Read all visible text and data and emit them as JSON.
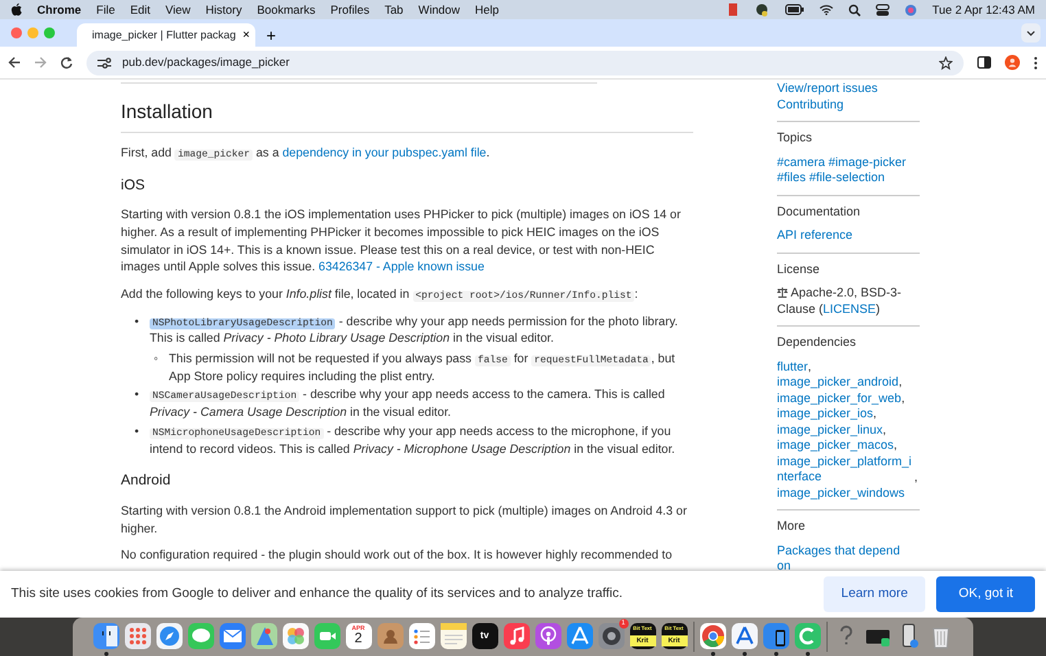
{
  "menu_bar": {
    "items": [
      {
        "label": "Chrome",
        "kind": "app"
      },
      {
        "label": "File",
        "kind": "menu"
      },
      {
        "label": "Edit",
        "kind": "menu"
      },
      {
        "label": "View",
        "kind": "menu"
      },
      {
        "label": "History",
        "kind": "menu"
      },
      {
        "label": "Bookmarks",
        "kind": "menu"
      },
      {
        "label": "Profiles",
        "kind": "menu"
      },
      {
        "label": "Tab",
        "kind": "menu"
      },
      {
        "label": "Window",
        "kind": "menu"
      },
      {
        "label": "Help",
        "kind": "menu"
      }
    ],
    "clock": "Tue 2 Apr  12:43 AM"
  },
  "tabs": [
    {
      "title": "image_picker | Flutter packag",
      "close": "×",
      "selected": true
    }
  ],
  "new_tab": "+",
  "address_bar": {
    "url": "pub.dev/packages/image_picker"
  },
  "content": [
    {
      "kind": "h2",
      "text": "Installation"
    },
    {
      "kind": "p",
      "parts": [
        {
          "kind": "text",
          "text": "First, add "
        },
        {
          "kind": "code",
          "text": "image_picker"
        },
        {
          "kind": "text",
          "text": " as a "
        },
        {
          "kind": "link",
          "text": "dependency in your pubspec.yaml file"
        },
        {
          "kind": "text",
          "text": "."
        }
      ]
    },
    {
      "kind": "h3",
      "text": "iOS"
    },
    {
      "kind": "p",
      "parts": [
        {
          "kind": "text",
          "text": "Starting with version 0.8.1 the iOS implementation uses PHPicker to pick (multiple) images on iOS 14 or higher. As a result of implementing PHPicker it becomes impossible to pick HEIC images on the iOS simulator in iOS 14+. This is a known issue. Please test this on a real device, or test with non-HEIC images until Apple solves this issue. "
        },
        {
          "kind": "link",
          "text": "63426347 - Apple known issue"
        }
      ]
    },
    {
      "kind": "p",
      "parts": [
        {
          "kind": "text",
          "text": "Add the following keys to your *Info.plist* file, located in "
        },
        {
          "kind": "code",
          "text": "<project root>/ios/Runner/Info.plist"
        },
        {
          "kind": "text",
          "text": ":"
        }
      ]
    },
    {
      "kind": "list",
      "items": [
        {
          "marker": "•",
          "parts": [
            {
              "kind": "code",
              "text": "NSPhotoLibraryUsageDescription",
              "highlighted": true
            },
            {
              "kind": "text",
              "text": " - describe why your app needs permission for the photo library. This is called *Privacy - Photo Library Usage Description* in the visual editor."
            }
          ],
          "children": [
            {
              "marker": "◦",
              "parts": [
                {
                  "kind": "text",
                  "text": "This permission will not be requested if you always pass "
                },
                {
                  "kind": "code",
                  "text": "false",
                  "highlighted": false
                },
                {
                  "kind": "text",
                  "text": " for "
                },
                {
                  "kind": "code",
                  "text": "requestFullMetadata",
                  "highlighted": false
                },
                {
                  "kind": "text",
                  "text": ", but App Store policy requires including the plist entry."
                }
              ]
            }
          ]
        },
        {
          "marker": "•",
          "parts": [
            {
              "kind": "code",
              "text": "NSCameraUsageDescription",
              "highlighted": false
            },
            {
              "kind": "text",
              "text": " - describe why your app needs access to the camera. This is called *Privacy - Camera Usage Description* in the visual editor."
            }
          ]
        },
        {
          "marker": "•",
          "parts": [
            {
              "kind": "code",
              "text": "NSMicrophoneUsageDescription",
              "highlighted": false
            },
            {
              "kind": "text",
              "text": " - describe why your app needs access to the microphone, if you intend to record videos. This is called *Privacy - Microphone Usage Description* in the visual editor."
            }
          ]
        }
      ]
    },
    {
      "kind": "h3",
      "text": "Android"
    },
    {
      "kind": "p",
      "parts": [
        {
          "kind": "text",
          "text": "Starting with version 0.8.1 the Android implementation support to pick (multiple) images on Android 4.3 or higher."
        }
      ]
    },
    {
      "kind": "p",
      "parts": [
        {
          "kind": "text",
          "text": "No configuration required - the plugin should work out of the box. It is however highly recommended to"
        }
      ]
    }
  ],
  "sidebar": [
    {
      "parts": [
        {
          "kind": "link",
          "text": "View/report issues"
        },
        {
          "kind": "break"
        },
        {
          "kind": "link",
          "text": "Contributing"
        }
      ]
    },
    {
      "title": "Topics",
      "parts": [
        {
          "kind": "link",
          "text": "#camera"
        },
        {
          "kind": "link",
          "text": "#image-picker"
        },
        {
          "kind": "link",
          "text": "#files"
        },
        {
          "kind": "link",
          "text": "#file-selection"
        }
      ]
    },
    {
      "title": "Documentation",
      "parts": [
        {
          "kind": "link",
          "text": "API reference"
        }
      ]
    },
    {
      "title": "License",
      "parts": [
        {
          "kind": "icon"
        },
        {
          "kind": "text",
          "text": " Apache-2.0, BSD-3-Clause ("
        },
        {
          "kind": "link",
          "text": "LICENSE"
        },
        {
          "kind": "text",
          "text": ")"
        }
      ]
    },
    {
      "title": "Dependencies",
      "parts": [
        {
          "kind": "link",
          "text": "flutter"
        },
        {
          "kind": "text",
          "text": ", "
        },
        {
          "kind": "link",
          "text": "image_picker_android"
        },
        {
          "kind": "text",
          "text": ", "
        },
        {
          "kind": "link",
          "text": "image_picker_for_web"
        },
        {
          "kind": "text",
          "text": ", "
        },
        {
          "kind": "link",
          "text": "image_picker_ios"
        },
        {
          "kind": "text",
          "text": ", "
        },
        {
          "kind": "link",
          "text": "image_picker_linux"
        },
        {
          "kind": "text",
          "text": ", "
        },
        {
          "kind": "link",
          "text": "image_picker_macos"
        },
        {
          "kind": "text",
          "text": ", "
        },
        {
          "kind": "link",
          "text": "image_picker_platform_interface"
        },
        {
          "kind": "text",
          "text": ", "
        },
        {
          "kind": "link",
          "text": "image_picker_windows"
        }
      ]
    },
    {
      "title": "More",
      "parts": [
        {
          "kind": "link",
          "text": "Packages that depend on"
        }
      ]
    }
  ],
  "cookie_banner": {
    "text": "This site uses cookies from Google to deliver and enhance the quality of its services and to analyze traffic.",
    "buttons": [
      {
        "label": "Learn more",
        "kind": "secondary"
      },
      {
        "label": "OK, got it",
        "kind": "primary"
      }
    ]
  },
  "dock": [
    {
      "kind": "finder",
      "running": true
    },
    {
      "kind": "launchpad",
      "running": false
    },
    {
      "kind": "safari",
      "running": false
    },
    {
      "kind": "messages",
      "running": false
    },
    {
      "kind": "mail",
      "running": false
    },
    {
      "kind": "maps",
      "running": false
    },
    {
      "kind": "photos",
      "running": false
    },
    {
      "kind": "facetime",
      "running": false
    },
    {
      "kind": "calendar",
      "month": "APR",
      "day": "2",
      "running": false
    },
    {
      "kind": "contacts",
      "running": false
    },
    {
      "kind": "reminders",
      "running": false
    },
    {
      "kind": "notes",
      "running": false
    },
    {
      "kind": "tv",
      "label": "tv",
      "running": false
    },
    {
      "kind": "music",
      "running": false
    },
    {
      "kind": "podcasts",
      "running": false
    },
    {
      "kind": "appstore",
      "running": false
    },
    {
      "kind": "settings",
      "badge": "1",
      "running": false
    },
    {
      "kind": "bittext",
      "top": "Bit Text",
      "bottom": "Krit",
      "running": false
    },
    {
      "kind": "bittext",
      "top": "Bit Text",
      "bottom": "Krit",
      "running": false
    },
    {
      "kind": "separator"
    },
    {
      "kind": "chrome",
      "running": true
    },
    {
      "kind": "devtool",
      "running": true
    },
    {
      "kind": "simulator",
      "running": true
    },
    {
      "kind": "green",
      "running": true
    },
    {
      "kind": "separator"
    },
    {
      "kind": "help",
      "running": false
    },
    {
      "kind": "device",
      "running": false
    },
    {
      "kind": "phone",
      "running": false
    },
    {
      "kind": "trash",
      "running": false
    }
  ]
}
